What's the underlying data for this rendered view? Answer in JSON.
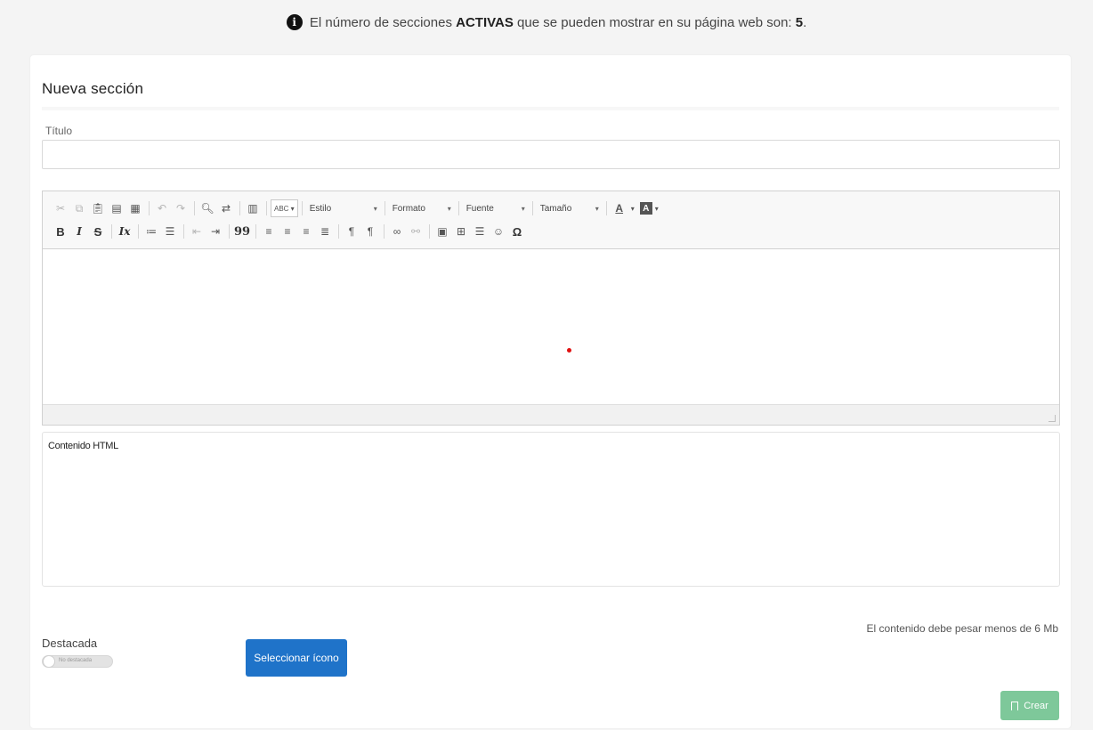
{
  "notice": {
    "prefix": "El número de secciones",
    "strong": "ACTIVAS",
    "suffix": "que se pueden mostrar en su página web son:",
    "count": "5",
    "end": "."
  },
  "form": {
    "title": "Nueva sección",
    "title_label": "Título",
    "title_value": "",
    "html_label": "Contenido HTML",
    "size_note": "El contenido debe pesar menos de 6 Mb",
    "featured_label": "Destacada",
    "featured_toggle_text": "No destacada",
    "select_icon_label": "Seleccionar ícono",
    "create_label": "Crear"
  },
  "toolbar": {
    "style_combo": "Estilo",
    "format_combo": "Formato",
    "font_combo": "Fuente",
    "size_combo": "Tamaño",
    "spell_label": "ABC",
    "text_color_label": "A",
    "bg_color_label": "A",
    "bold_label": "B",
    "italic_label": "I",
    "strike_label": "S",
    "clear_format_label": "Ix",
    "quote_label": "99",
    "omega_label": "Ω"
  },
  "colors": {
    "primary_button": "#1f73c9",
    "create_button": "#7ec89a",
    "cursor_dot": "#e01010"
  }
}
